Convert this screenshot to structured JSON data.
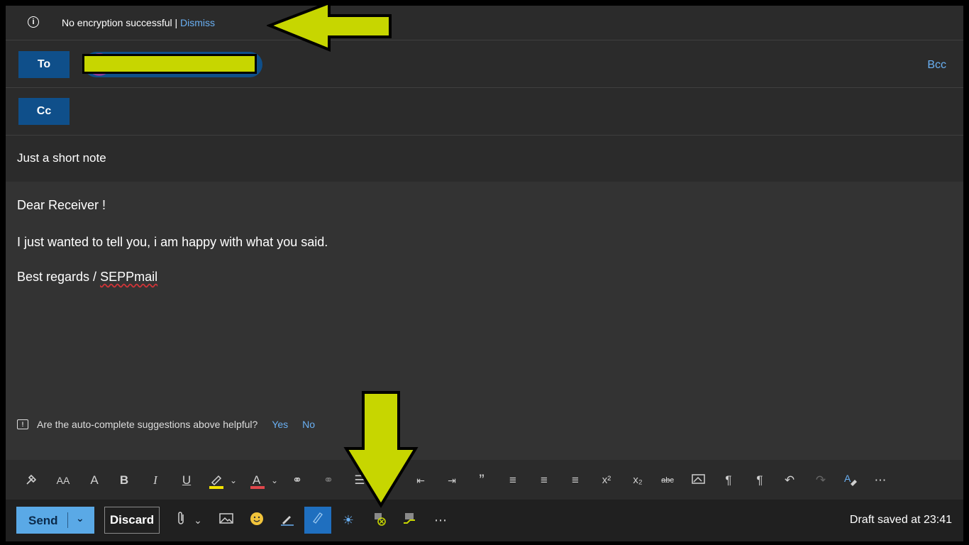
{
  "info_bar": {
    "message": "No encryption successful |",
    "dismiss_label": "Dismiss"
  },
  "to_button": "To",
  "cc_button": "Cc",
  "bcc_label": "Bcc",
  "subject": "Just a short note",
  "body": {
    "line1": "Dear Receiver !",
    "line2": "I just wanted to tell you, i am happy with what you said.",
    "line3_prefix": "Best regards / ",
    "line3_signature": "SEPPmail"
  },
  "feedback": {
    "question": "Are the auto-complete suggestions above helpful?",
    "yes": "Yes",
    "no": "No"
  },
  "actions": {
    "send": "Send",
    "discard": "Discard",
    "draft_status": "Draft saved at 23:41"
  },
  "colors": {
    "accent": "#5aa9e6",
    "field_button": "#0f4f8a",
    "highlight_arrow": "#c7d600",
    "link": "#6ab0f3"
  },
  "format_icons": [
    "format-painter-icon",
    "font-size-icon",
    "grow-font-icon",
    "bold-icon",
    "italic-icon",
    "underline-icon",
    "highlight-icon",
    "font-color-icon",
    "insert-link-icon",
    "remove-link-icon",
    "bullets-icon",
    "numbering-icon",
    "decrease-indent-icon",
    "increase-indent-icon",
    "quote-icon",
    "align-left-icon",
    "align-center-icon",
    "align-right-icon",
    "superscript-icon",
    "subscript-icon",
    "strikethrough-icon",
    "clear-formatting-icon",
    "ltr-icon",
    "rtl-icon",
    "undo-icon",
    "redo-icon",
    "styles-icon",
    "more-icon"
  ]
}
